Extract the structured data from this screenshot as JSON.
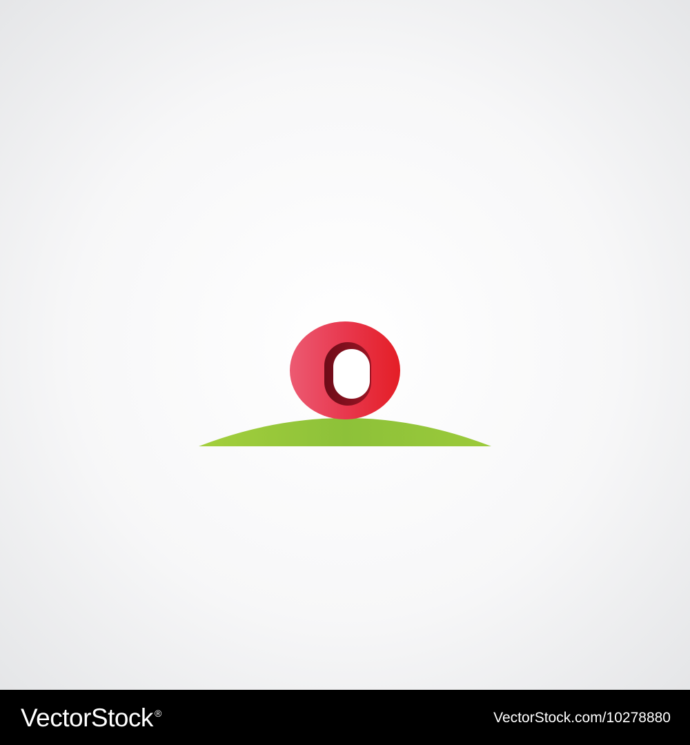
{
  "logo": {
    "glyph": "0",
    "colors": {
      "red_light": "#ec5a72",
      "red_main": "#e41e26",
      "red_dark": "#7a0e1c",
      "green_light": "#a3cf3c",
      "green_dark": "#6fb02c",
      "background_center": "#ffffff",
      "background_edge": "#e4e5e7"
    }
  },
  "footer": {
    "brand": "VectorStock",
    "brand_mark": "®",
    "image_id": "VectorStock.com/10278880",
    "background": "#000000"
  }
}
